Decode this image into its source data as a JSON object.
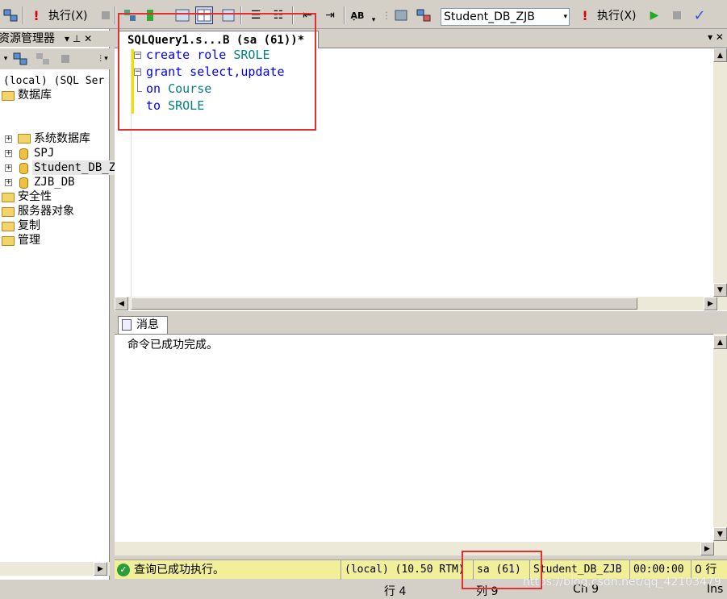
{
  "toolbar": {
    "execute_label_left": "执行(X)",
    "execute_label_right": "执行(X)",
    "database_select": "Student_DB_ZJB"
  },
  "object_explorer": {
    "title": "资源管理器",
    "pin": "▾ ⊥ ✕",
    "server": "(local) (SQL Ser",
    "nodes": [
      {
        "label": "数据库"
      },
      {
        "label": "系统数据库"
      },
      {
        "label": "SPJ"
      },
      {
        "label": "Student_DB_Z"
      },
      {
        "label": "ZJB_DB"
      },
      {
        "label": "安全性"
      },
      {
        "label": "服务器对象"
      },
      {
        "label": "复制"
      },
      {
        "label": "管理"
      }
    ]
  },
  "editor": {
    "tab_title": "SQLQuery1.s...B (sa (61))*",
    "close": "▾ ✕",
    "lines": [
      {
        "kw": "create role ",
        "id": "SROLE"
      },
      {
        "kw": "grant select,update",
        "id": ""
      },
      {
        "kw": "on ",
        "id": "Course"
      },
      {
        "kw": "to ",
        "id": "SROLE"
      }
    ]
  },
  "results": {
    "tab_label": "消息",
    "message": "命令已成功完成。"
  },
  "status": {
    "message": "查询已成功执行。",
    "server": "(local) (10.50 RTM)",
    "user": "sa (61)",
    "database": "Student_DB_ZJB",
    "time": "00:00:00",
    "rows": "0 行"
  },
  "bottom": {
    "line": "行 4",
    "col": "列 9",
    "ch": "Ch 9",
    "mode": "Ins",
    "watermark": "https://blog.csdn.net/qq_42103479"
  }
}
